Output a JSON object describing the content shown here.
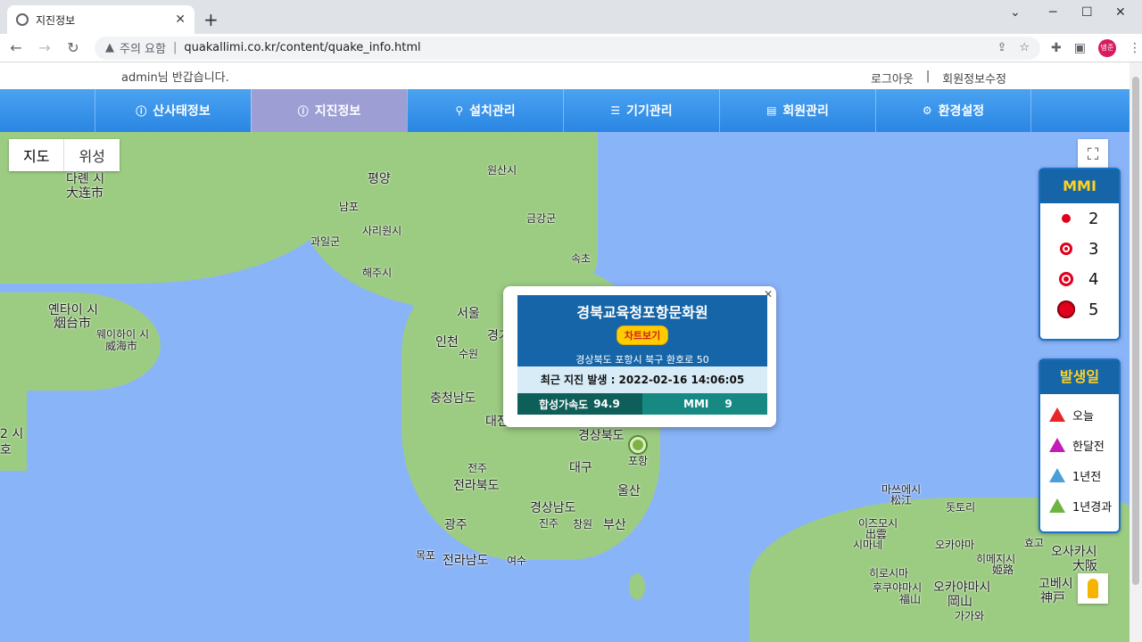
{
  "browser": {
    "tab_title": "지진정보",
    "address_prefix": "주의 요함",
    "url": "quakallimi.co.kr/content/quake_info.html",
    "avatar_text": "병준"
  },
  "header": {
    "greeting": "admin님 반갑습니다.",
    "logout": "로그아웃",
    "separator": "|",
    "profile_edit": "회원정보수정"
  },
  "nav": {
    "items": [
      {
        "label": "산사태정보",
        "icon": "info-icon"
      },
      {
        "label": "지진정보",
        "icon": "info-icon",
        "active": true
      },
      {
        "label": "설치관리",
        "icon": "map-marker-icon"
      },
      {
        "label": "기기관리",
        "icon": "database-icon"
      },
      {
        "label": "회원관리",
        "icon": "id-card-icon"
      },
      {
        "label": "환경설정",
        "icon": "gear-icon"
      }
    ]
  },
  "map": {
    "type_map": "지도",
    "type_satellite": "위성",
    "labels": [
      "다롄 시",
      "大连市",
      "평양",
      "원산시",
      "남포",
      "사리원시",
      "금강군",
      "과일군",
      "해주시",
      "속초",
      "옌타이 시",
      "烟台市",
      "웨이하이 시",
      "威海市",
      "서울",
      "인천",
      "수원",
      "경기도",
      "충청남도",
      "대전",
      "경상북도",
      "포항",
      "대구",
      "전주",
      "전라북도",
      "울산",
      "경상남도",
      "진주",
      "창원",
      "부산",
      "광주",
      "목포",
      "전라남도",
      "여수",
      "마쓰에시",
      "松江",
      "돗토리",
      "이즈모시",
      "出雲",
      "시마네",
      "오카야마",
      "효고",
      "오사카시",
      "大阪",
      "히로시마",
      "히메지시",
      "姫路",
      "고베시",
      "神戸",
      "후쿠야마시",
      "福山",
      "오카야마시",
      "岡山",
      "가가와",
      "2 시",
      "호"
    ]
  },
  "popup": {
    "title": "경북교육청포항문화원",
    "chart_button": "차트보기",
    "address": "경상북도 포항시 북구 환호로 50",
    "recent_label": "최근 지진 발생 : 2022-02-16 14:06:05",
    "accel_label": "합성가속도",
    "accel_value": "94.9",
    "mmi_label": "MMI",
    "mmi_value": "9"
  },
  "legend_mmi": {
    "title": "MMI",
    "levels": [
      "2",
      "3",
      "4",
      "5"
    ],
    "color": "#e0001b"
  },
  "legend_date": {
    "title": "발생일",
    "items": [
      {
        "label": "오늘",
        "color": "#e8262a"
      },
      {
        "label": "한달전",
        "color": "#c41ab8"
      },
      {
        "label": "1년전",
        "color": "#4a9fd8"
      },
      {
        "label": "1년경과",
        "color": "#6cb33f"
      }
    ]
  }
}
